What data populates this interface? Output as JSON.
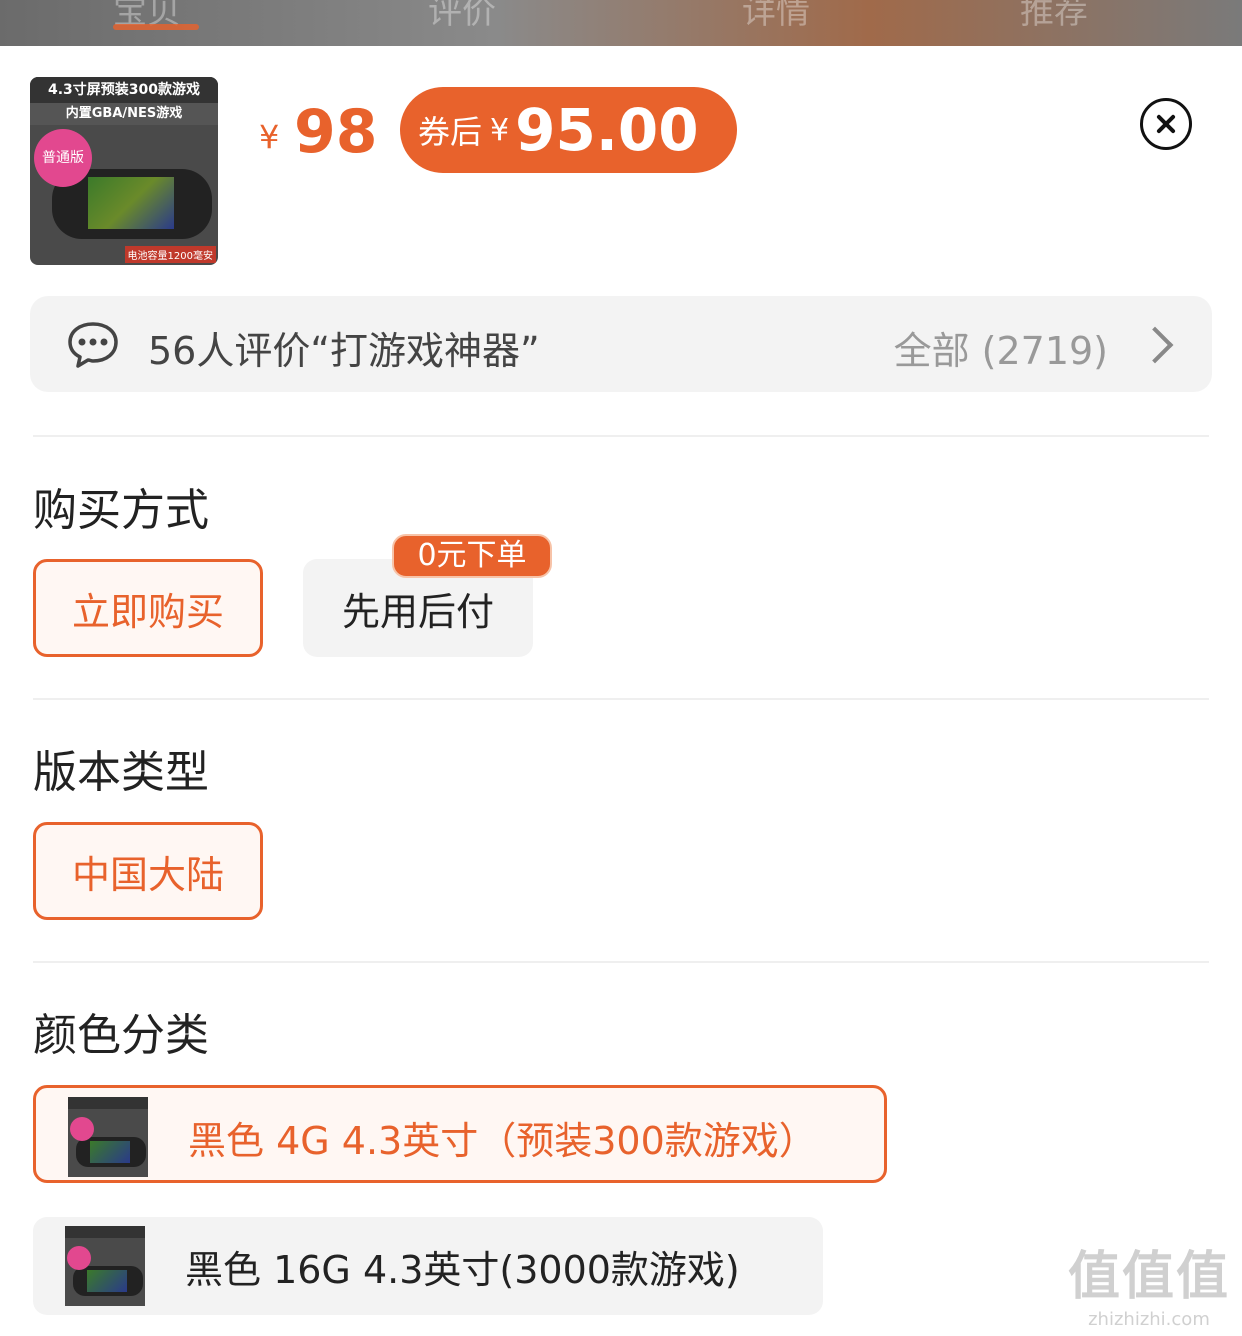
{
  "tabs": [
    "宝贝",
    "评价",
    "详情",
    "推荐"
  ],
  "product": {
    "thumb_line1": "4.3寸屏预装300款游戏",
    "thumb_line2": "内置GBA/NES游戏",
    "thumb_badge": "普通版",
    "thumb_bottom": "电池容量1200毫安",
    "price_symbol": "¥",
    "price": "98",
    "coupon_label": "券后",
    "coupon_symbol": "¥",
    "coupon_price": "95.00"
  },
  "reviews": {
    "summary": "56人评价“打游戏神器”",
    "all_label": "全部 (2719)"
  },
  "purchase": {
    "title": "购买方式",
    "options": [
      "立即购买",
      "先用后付"
    ],
    "tag": "0元下单"
  },
  "version": {
    "title": "版本类型",
    "options": [
      "中国大陆"
    ]
  },
  "color": {
    "title": "颜色分类",
    "options": [
      "黑色 4G 4.3英寸（预装300款游戏）",
      "黑色 16G 4.3英寸(3000款游戏)"
    ]
  },
  "watermark": {
    "big": "值值值",
    "small": "zhizhizhi.com"
  },
  "colors": {
    "accent": "#e8622c",
    "accent_bg": "#fff7f3",
    "gray_bg": "#f3f3f3"
  }
}
